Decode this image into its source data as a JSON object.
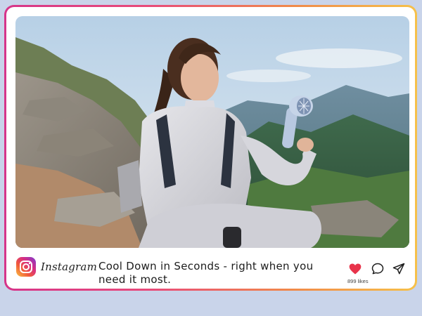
{
  "post": {
    "brand": {
      "icon": "instagram-icon",
      "name": "Instagram"
    },
    "caption": "Cool Down in Seconds - right when you need it most.",
    "actions": {
      "like_icon": "heart-icon",
      "comment_icon": "comment-icon",
      "share_icon": "send-icon",
      "liked": true,
      "like_color": "#e8334a"
    },
    "likes_text": "899 likes"
  },
  "theme": {
    "frame_gradient": [
      "#d6358a",
      "#f08a4a",
      "#f6c14a"
    ],
    "page_background": "#c9d4ea"
  }
}
